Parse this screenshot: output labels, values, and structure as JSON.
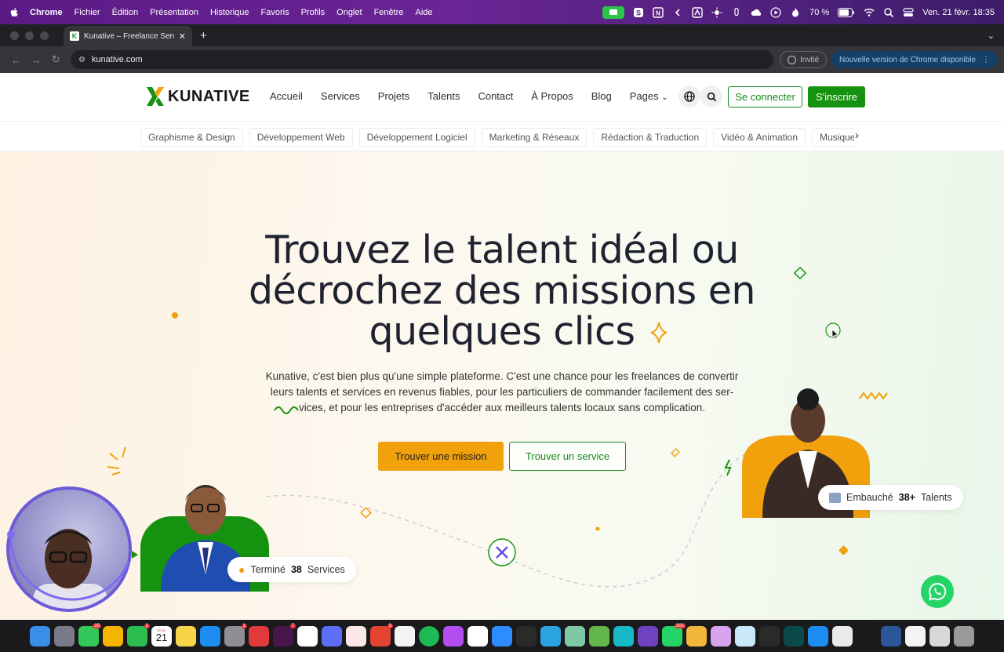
{
  "menubar": {
    "items": [
      "Chrome",
      "Fichier",
      "Édition",
      "Présentation",
      "Historique",
      "Favoris",
      "Profils",
      "Onglet",
      "Fenêtre",
      "Aide"
    ],
    "battery": "70 %",
    "datetime": "Ven. 21 févr. 18:35"
  },
  "browser": {
    "tab_title": "Kunative – Freelance Services",
    "url": "kunative.com",
    "profile_label": "Invité",
    "update_label": "Nouvelle version de Chrome disponible"
  },
  "site": {
    "logo_text": "KUNATIVE",
    "nav": [
      "Accueil",
      "Services",
      "Projets",
      "Talents",
      "Contact",
      "À Propos",
      "Blog",
      "Pages"
    ],
    "login_label": "Se connecter",
    "signup_label": "S'inscrire",
    "categories": [
      "Graphisme & Design",
      "Développement Web",
      "Développement Logiciel",
      "Marketing & Réseaux",
      "Rédaction & Traduction",
      "Vidéo & Animation",
      "Musique & Audio"
    ],
    "colors": {
      "brand_green": "#15920f",
      "accent_orange": "#f1a10b"
    }
  },
  "hero": {
    "title_line1": "Trouvez le talent idéal ou",
    "title_line2": "décrochez des missions en",
    "title_line3": "quelques clics",
    "subtitle_line1": "Kunative, c'est bien plus qu'une simple plateforme. C'est une chance pour les freelances de convertir",
    "subtitle_line2": "leurs talents et services en revenus fiables, pour les particuliers de commander facilement des ser-",
    "subtitle_line3": "vices, et pour les entreprises d'accéder aux meilleurs talents locaux sans complication.",
    "cta_primary": "Trouver une mission",
    "cta_secondary": "Trouver un service",
    "badge_services_prefix": "Terminé",
    "badge_services_count": "38",
    "badge_services_suffix": "Services",
    "badge_talents_prefix": "Embauché",
    "badge_talents_count": "38+",
    "badge_talents_suffix": "Talents"
  },
  "dock": {
    "badges": [
      "25",
      "2",
      "1",
      "7",
      "3",
      "202"
    ],
    "calendar_day": "21",
    "calendar_month": "FÉVR."
  }
}
